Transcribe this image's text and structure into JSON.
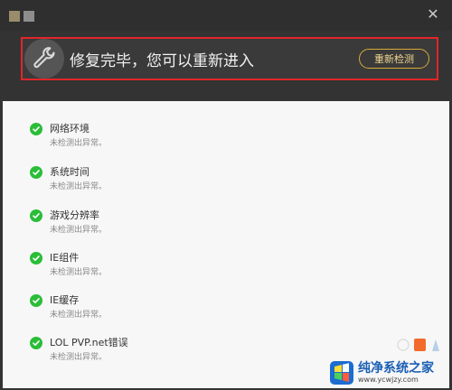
{
  "window": {
    "close_glyph": "✕"
  },
  "banner": {
    "title": "修复完毕，您可以重新进入",
    "recheck_button": "重新检测"
  },
  "checks": [
    {
      "title": "网络环境",
      "status": "未检测出异常。"
    },
    {
      "title": "系统时间",
      "status": "未检测出异常。"
    },
    {
      "title": "游戏分辨率",
      "status": "未检测出异常。"
    },
    {
      "title": "IE组件",
      "status": "未检测出异常。"
    },
    {
      "title": "IE缓存",
      "status": "未检测出异常。"
    },
    {
      "title": "LOL PVP.net错误",
      "status": "未检测出异常。"
    }
  ],
  "watermark": {
    "name": "纯净系统之家",
    "url": "www.ycwjzy.com"
  },
  "colors": {
    "banner_border": "#e0262a",
    "check_green": "#2bbd38",
    "button_gold": "#d8aa3b"
  }
}
